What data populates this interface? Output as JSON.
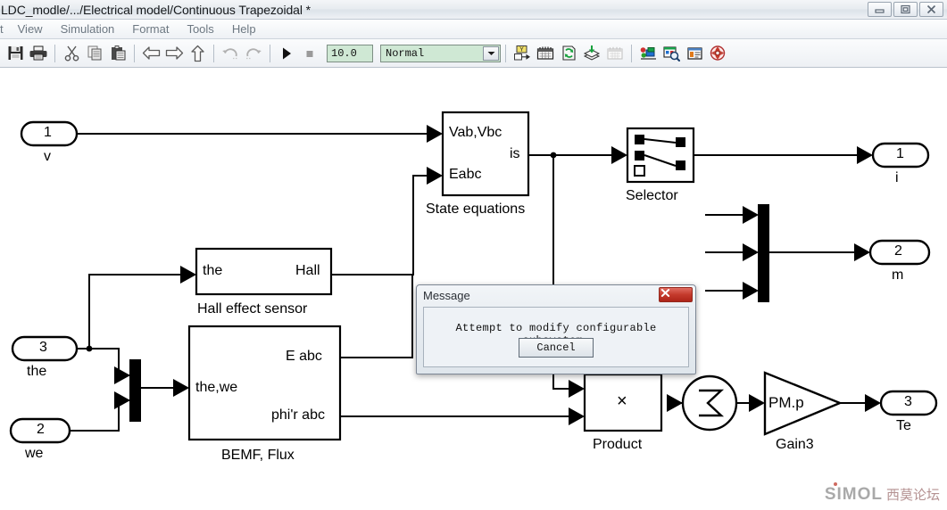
{
  "window": {
    "title": "LDC_modle/.../Electrical model/Continuous Trapezoidal *",
    "controls": {
      "minimize": "minimize-icon",
      "maximize": "maximize-icon",
      "close": "close-icon"
    }
  },
  "menubar": {
    "items": [
      {
        "label": "t"
      },
      {
        "label": "View"
      },
      {
        "label": "Simulation"
      },
      {
        "label": "Format"
      },
      {
        "label": "Tools"
      },
      {
        "label": "Help"
      }
    ]
  },
  "toolbar": {
    "buttons": [
      {
        "name": "save-button",
        "icon": "save-icon"
      },
      {
        "name": "print-button",
        "icon": "print-icon"
      },
      {
        "name": "cut-button",
        "icon": "scissors-icon"
      },
      {
        "name": "copy-button",
        "icon": "copy-icon"
      },
      {
        "name": "paste-button",
        "icon": "paste-icon"
      },
      {
        "name": "back-button",
        "icon": "arrow-left-icon"
      },
      {
        "name": "forward-button",
        "icon": "arrow-right-icon"
      },
      {
        "name": "up-button",
        "icon": "arrow-up-icon"
      },
      {
        "name": "undo-button",
        "icon": "undo-icon"
      },
      {
        "name": "redo-button",
        "icon": "redo-icon"
      },
      {
        "name": "start-simulation-button",
        "icon": "play-icon"
      },
      {
        "name": "stop-simulation-button",
        "icon": "stop-icon"
      }
    ],
    "simulation_time": "10.0",
    "simulation_mode": "Normal",
    "right_buttons": [
      {
        "name": "library-browser-button",
        "icon": "library-browser-icon"
      },
      {
        "name": "model-explorer-button",
        "icon": "model-explorer-icon"
      },
      {
        "name": "update-diagram-button",
        "icon": "update-diagram-icon"
      },
      {
        "name": "build-model-button",
        "icon": "build-model-icon"
      },
      {
        "name": "toggle-grid-button",
        "icon": "grid-icon"
      },
      {
        "name": "debug-button",
        "icon": "debug-icon"
      },
      {
        "name": "find-button",
        "icon": "find-icon"
      },
      {
        "name": "report-button",
        "icon": "report-icon"
      },
      {
        "name": "help-button",
        "icon": "help-icon"
      }
    ]
  },
  "diagram": {
    "inports": [
      {
        "number": "1",
        "label": "v"
      },
      {
        "number": "3",
        "label": "the"
      },
      {
        "number": "2",
        "label": "we"
      }
    ],
    "outports": [
      {
        "number": "1",
        "label": "i"
      },
      {
        "number": "2",
        "label": "m"
      },
      {
        "number": "3",
        "label": "Te"
      }
    ],
    "blocks": [
      {
        "name": "state-equations-block",
        "caption": "State equations",
        "inputs": [
          "Vab,Vbc",
          "Eabc"
        ],
        "outputs": [
          "is"
        ]
      },
      {
        "name": "selector-block",
        "caption": "Selector",
        "inputs": [],
        "outputs": []
      },
      {
        "name": "hall-effect-sensor-block",
        "caption": "Hall effect sensor",
        "inputs": [
          "the"
        ],
        "outputs": [
          "Hall"
        ]
      },
      {
        "name": "bemf-flux-block",
        "caption": "BEMF, Flux",
        "inputs": [
          "the,we"
        ],
        "outputs": [
          "E abc",
          "phi'r abc"
        ]
      },
      {
        "name": "product-block",
        "caption": "Product",
        "symbol": "×"
      },
      {
        "name": "sum-block",
        "caption": "",
        "symbol": "Σ"
      },
      {
        "name": "gain3-block",
        "caption": "Gain3",
        "symbol": "PM.p"
      }
    ]
  },
  "dialog": {
    "title": "Message",
    "message": "Attempt to modify configurable subsystem.",
    "cancel_label": "Cancel",
    "close_icon": "close-icon"
  },
  "watermark": {
    "brand": "SIMOL",
    "chinese": "西莫论坛"
  },
  "colors": {
    "simulink_field": "#cfe8d4",
    "dialog_close": "#c43a2c",
    "wire": "#000000"
  }
}
